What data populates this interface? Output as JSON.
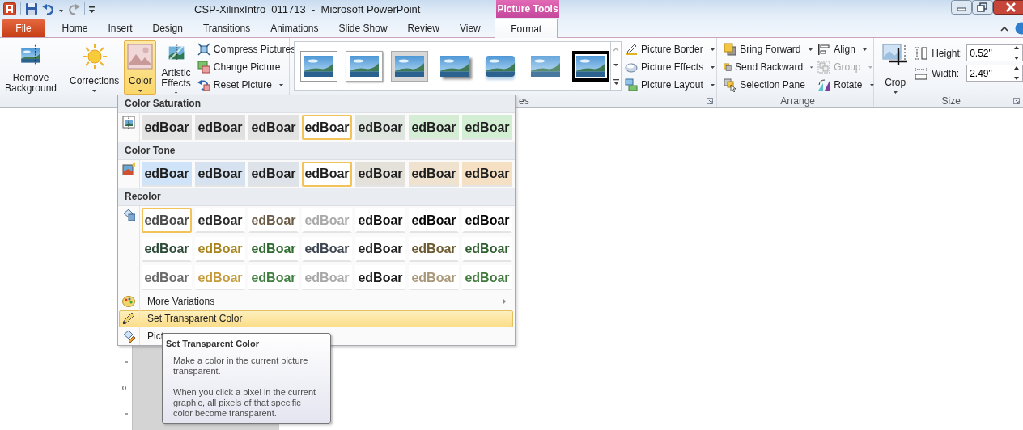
{
  "title_bar": {
    "title": "CSP-XilinxIntro_011713  -  Microsoft PowerPoint",
    "context_label": "Picture Tools"
  },
  "tabs": [
    {
      "label": "File",
      "kind": "file",
      "selected": false
    },
    {
      "label": "Home",
      "kind": "plain",
      "selected": false
    },
    {
      "label": "Insert",
      "kind": "plain",
      "selected": false
    },
    {
      "label": "Design",
      "kind": "plain",
      "selected": false
    },
    {
      "label": "Transitions",
      "kind": "plain",
      "selected": false
    },
    {
      "label": "Animations",
      "kind": "plain",
      "selected": false
    },
    {
      "label": "Slide Show",
      "kind": "plain",
      "selected": false
    },
    {
      "label": "Review",
      "kind": "plain",
      "selected": false
    },
    {
      "label": "View",
      "kind": "plain",
      "selected": false
    },
    {
      "label": "Format",
      "kind": "context",
      "selected": true
    }
  ],
  "ribbon": {
    "adjust": {
      "remove_background": "Remove Background",
      "corrections": "Corrections",
      "color": {
        "label": "Color",
        "pressed": true
      },
      "artistic_effects": "Artistic Effects",
      "compress": "Compress Pictures",
      "change": "Change Picture",
      "reset": "Reset Picture"
    },
    "styles": {
      "label": "es",
      "gallery": [
        {
          "kind": "simple"
        },
        {
          "kind": "beveled"
        },
        {
          "kind": "thick"
        },
        {
          "kind": "shadow"
        },
        {
          "kind": "reflected"
        },
        {
          "kind": "soft"
        },
        {
          "kind": "matte"
        }
      ],
      "border": "Picture Border",
      "effects": "Picture Effects",
      "layout": "Picture Layout"
    },
    "arrange": {
      "label": "Arrange",
      "items": [
        {
          "label": "Bring Forward",
          "dropdown": true,
          "disabled": false
        },
        {
          "label": "Send Backward",
          "dropdown": true,
          "disabled": false
        },
        {
          "label": "Selection Pane",
          "dropdown": false,
          "disabled": false
        },
        {
          "label": "Align",
          "dropdown": true,
          "disabled": false
        },
        {
          "label": "Group",
          "dropdown": true,
          "disabled": true
        },
        {
          "label": "Rotate",
          "dropdown": true,
          "disabled": false
        }
      ]
    },
    "size": {
      "label": "Size",
      "crop": "Crop",
      "height_label": "Height:",
      "height": "0.52\"",
      "width_label": "Width:",
      "width": "2.49\""
    }
  },
  "color_menu": {
    "sections": [
      {
        "title": "Color Saturation",
        "kind": "tint",
        "rows": [
          [
            {
              "text": "edBoar",
              "color": "#e2e2e2",
              "selected": false
            },
            {
              "text": "edBoar",
              "color": "#e0e0e0",
              "selected": false
            },
            {
              "text": "edBoar",
              "color": "#e1e2e1",
              "selected": false
            },
            {
              "text": "edBoar",
              "color": "#ffffff",
              "selected": true
            },
            {
              "text": "edBoar",
              "color": "#dfe6df",
              "selected": false
            },
            {
              "text": "edBoar",
              "color": "#d5ecd5",
              "selected": false
            },
            {
              "text": "edBoar",
              "color": "#d3efd3",
              "selected": false
            }
          ]
        ]
      },
      {
        "title": "Color Tone",
        "kind": "tint",
        "rows": [
          [
            {
              "text": "edBoar",
              "color": "#cfe4f8",
              "selected": false
            },
            {
              "text": "edBoar",
              "color": "#d6e2ef",
              "selected": false
            },
            {
              "text": "edBoar",
              "color": "#dde3e9",
              "selected": false
            },
            {
              "text": "edBoar",
              "color": "#ffffff",
              "selected": true
            },
            {
              "text": "edBoar",
              "color": "#e3e1da",
              "selected": false
            },
            {
              "text": "edBoar",
              "color": "#efe3cf",
              "selected": false
            },
            {
              "text": "edBoar",
              "color": "#f5e0c4",
              "selected": false
            }
          ]
        ]
      },
      {
        "title": "Recolor",
        "kind": "ink",
        "rows": [
          [
            {
              "text": "edBoar",
              "color": "#4a4a4a",
              "selected": true
            },
            {
              "text": "edBoar",
              "color": "#2a2a2a",
              "selected": false
            },
            {
              "text": "edBoar",
              "color": "#6b5a45",
              "selected": false
            },
            {
              "text": "edBoar",
              "color": "#a9a9a9",
              "selected": false
            },
            {
              "text": "edBoar",
              "color": "#111111",
              "selected": false
            },
            {
              "text": "edBoar",
              "color": "#050505",
              "selected": false
            },
            {
              "text": "edBoar",
              "color": "#000000",
              "selected": false
            }
          ],
          [
            {
              "text": "edBoar",
              "color": "#2d4a38",
              "selected": false
            },
            {
              "text": "edBoar",
              "color": "#a7831c",
              "selected": false
            },
            {
              "text": "edBoar",
              "color": "#2e6b2e",
              "selected": false
            },
            {
              "text": "edBoar",
              "color": "#3c4450",
              "selected": false
            },
            {
              "text": "edBoar",
              "color": "#222222",
              "selected": false
            },
            {
              "text": "edBoar",
              "color": "#6b5a30",
              "selected": false
            },
            {
              "text": "edBoar",
              "color": "#2e5e2e",
              "selected": false
            }
          ],
          [
            {
              "text": "edBoar",
              "color": "#6a6a6a",
              "selected": false
            },
            {
              "text": "edBoar",
              "color": "#c49a3a",
              "selected": false
            },
            {
              "text": "edBoar",
              "color": "#3f7f3f",
              "selected": false
            },
            {
              "text": "edBoar",
              "color": "#a8a8a8",
              "selected": false
            },
            {
              "text": "edBoar",
              "color": "#1a1a1a",
              "selected": false
            },
            {
              "text": "edBoar",
              "color": "#a89878",
              "selected": false
            },
            {
              "text": "edBoar",
              "color": "#3f7a3a",
              "selected": false
            }
          ]
        ]
      }
    ],
    "items": [
      {
        "label": "More Variations",
        "submenu": true,
        "selected": false
      },
      {
        "label": "Set Transparent Color",
        "submenu": false,
        "selected": true
      },
      {
        "label": "Pict",
        "submenu": false,
        "selected": false
      }
    ]
  },
  "tooltip": {
    "title": "Set Transparent Color",
    "paragraphs": [
      "Make a color in the current picture transparent.",
      "When you click a pixel in the current graphic, all pixels of that specific color become transparent."
    ]
  },
  "ruler_label": "0"
}
